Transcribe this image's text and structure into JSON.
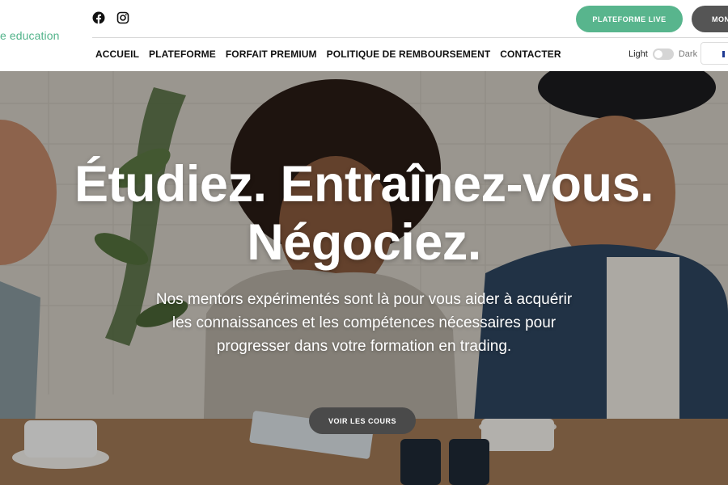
{
  "brand": {
    "logo_text": "e education"
  },
  "header": {
    "live_button": "PLATEFORME LIVE",
    "secondary_button": "MON",
    "nav": [
      "ACCUEIL",
      "PLATEFORME",
      "FORFAIT PREMIUM",
      "POLITIQUE DE REMBOURSEMENT",
      "CONTACTER"
    ],
    "theme": {
      "light_label": "Light",
      "dark_label": "Dark",
      "mode": "light"
    }
  },
  "hero": {
    "headline_line1": "Étudiez. Entraînez-vous.",
    "headline_line2": "Négociez.",
    "subtitle": "Nos mentors expérimentés sont là pour vous aider à acquérir les connaissances et les compétences nécessaires pour progresser dans votre formation en trading.",
    "cta": "VOIR LES COURS"
  },
  "colors": {
    "accent": "#58b58d",
    "dark_button": "#555555",
    "cta": "#4a4a4a"
  },
  "icons": [
    "facebook-icon",
    "instagram-icon",
    "flag-icon"
  ]
}
